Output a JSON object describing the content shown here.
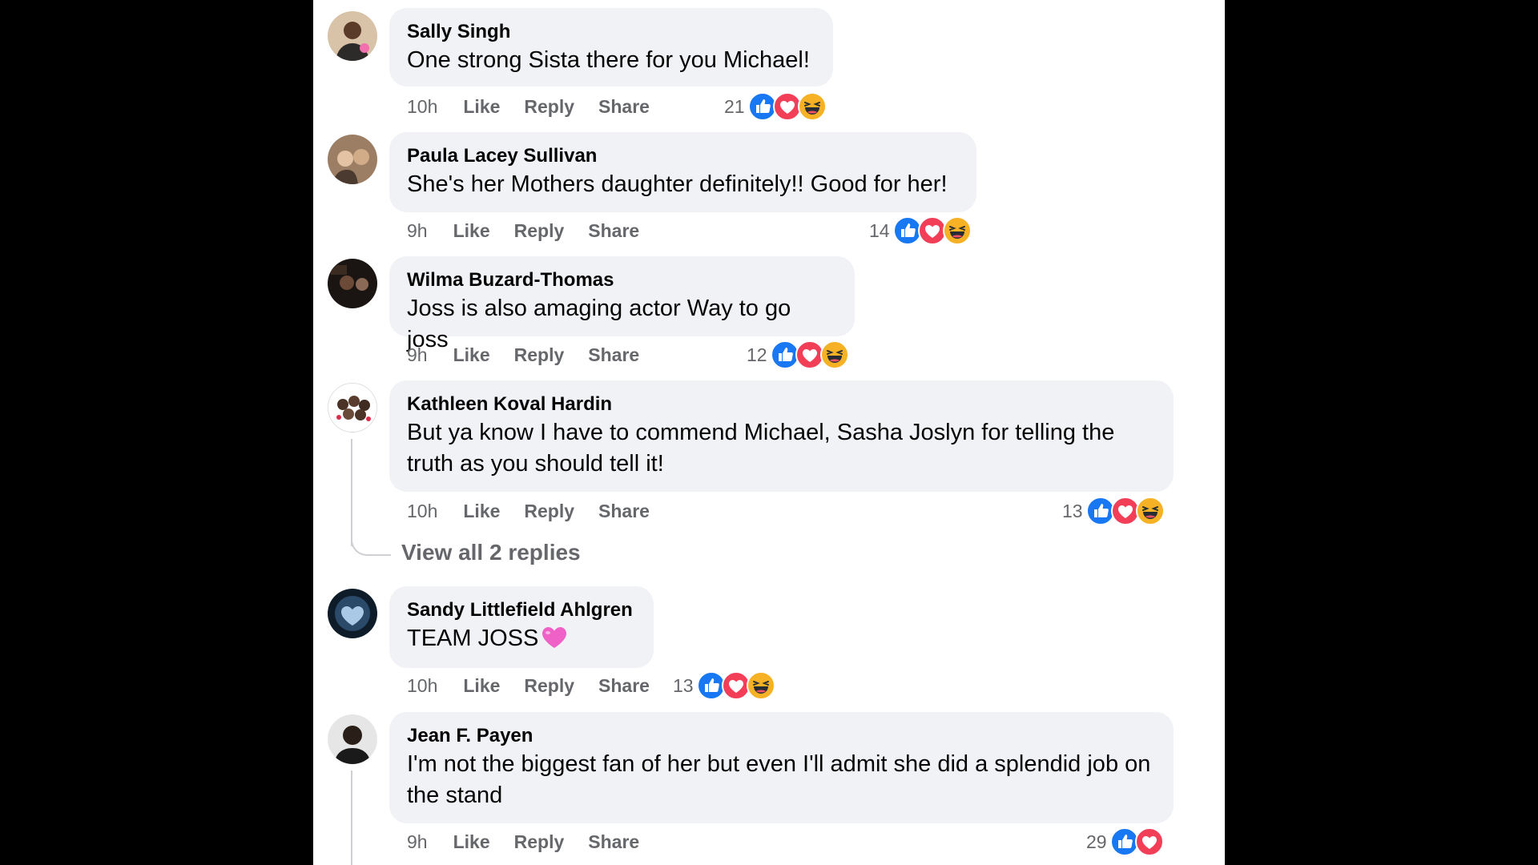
{
  "actions": {
    "like": "Like",
    "reply": "Reply",
    "share": "Share"
  },
  "comments": [
    {
      "author": "Sally Singh",
      "text": "One strong Sista there for you Michael!",
      "time": "10h",
      "reactions_count": "21",
      "reactions": [
        "like",
        "love",
        "haha"
      ]
    },
    {
      "author": "Paula Lacey Sullivan",
      "text": "She's her Mothers daughter definitely!! Good for her!",
      "time": "9h",
      "reactions_count": "14",
      "reactions": [
        "like",
        "love",
        "haha"
      ]
    },
    {
      "author": "Wilma Buzard-Thomas",
      "text": "Joss is also amaging actor Way to go joss",
      "time": "9h",
      "reactions_count": "12",
      "reactions": [
        "like",
        "love",
        "haha"
      ]
    },
    {
      "author": "Kathleen Koval Hardin",
      "text": "But ya know I have to commend Michael, Sasha Joslyn for telling the truth as you should tell it!",
      "time": "10h",
      "reactions_count": "13",
      "reactions": [
        "like",
        "love",
        "haha"
      ],
      "replies_link": "View all 2 replies"
    },
    {
      "author": "Sandy Littlefield Ahlgren",
      "text": "TEAM JOSS",
      "emoji": "pink-heart",
      "time": "10h",
      "reactions_count": "13",
      "reactions": [
        "like",
        "love",
        "haha"
      ]
    },
    {
      "author": "Jean F. Payen",
      "text": "I'm not the biggest fan of her but even I'll admit she did a splendid job on the stand",
      "time": "9h",
      "reactions_count": "29",
      "reactions": [
        "like",
        "love"
      ]
    }
  ],
  "colors": {
    "like": "#1877f2",
    "love": "#f33e58",
    "haha": "#f7b125",
    "bubble": "#f0f2f5",
    "meta": "#65676b"
  }
}
